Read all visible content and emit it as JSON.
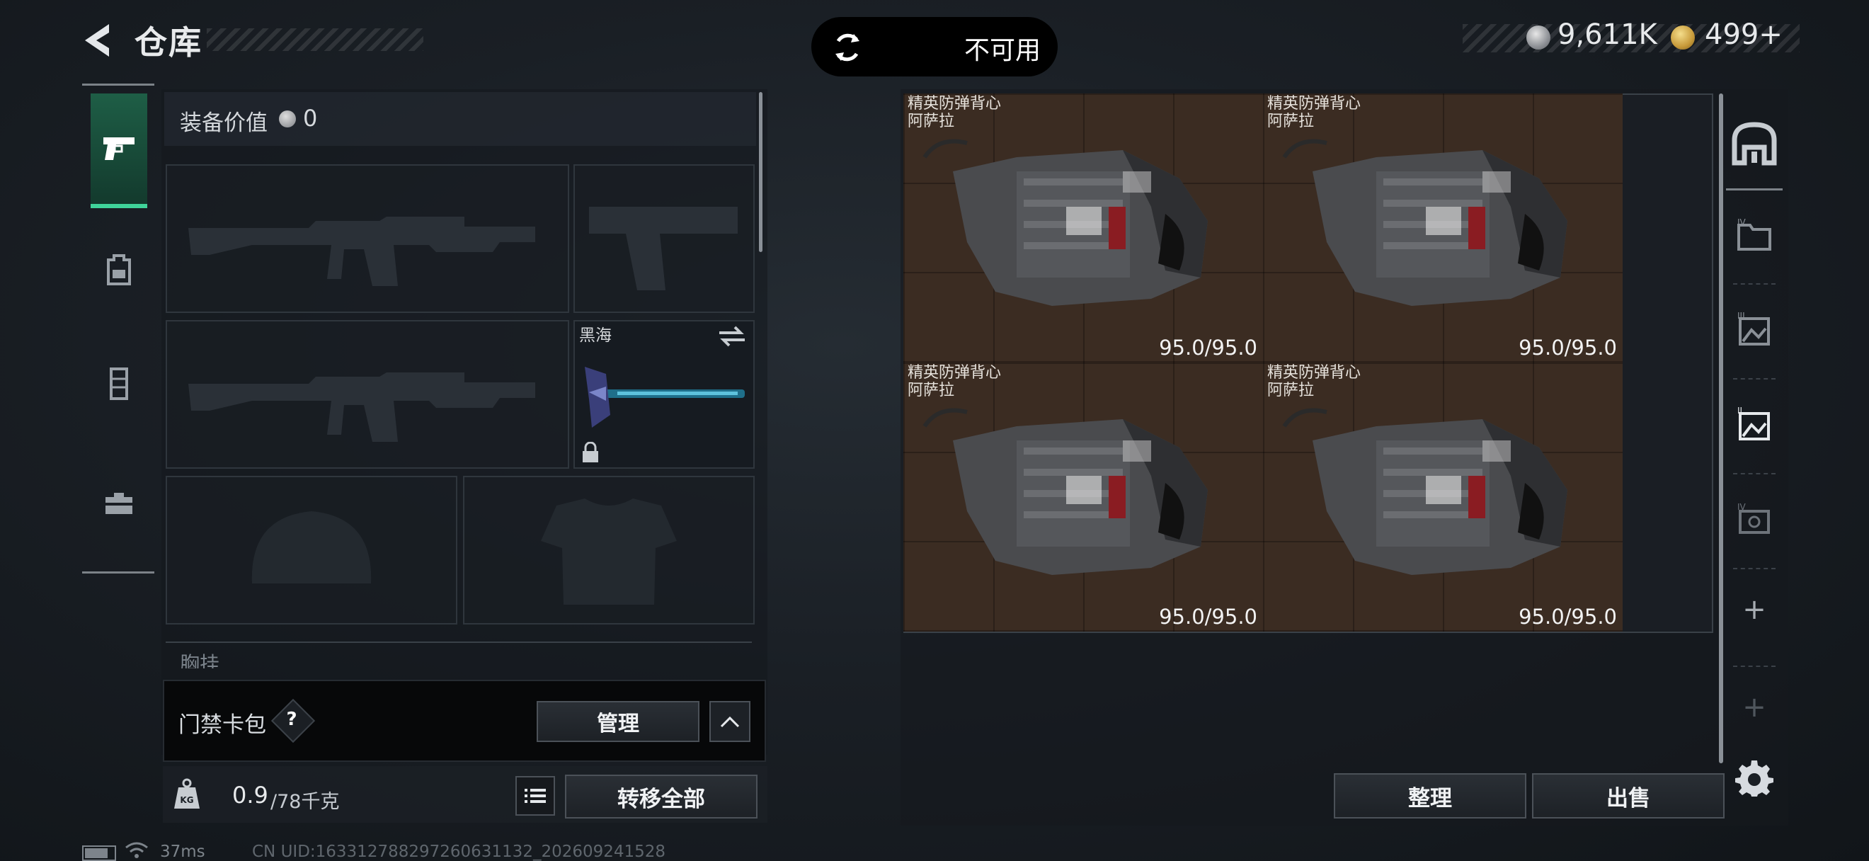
{
  "header": {
    "title": "仓库",
    "status_text": "不可用",
    "currency_1": "9,611K",
    "currency_2": "499+"
  },
  "left_tabs": [
    {
      "icon": "pistol-icon",
      "active": true
    },
    {
      "icon": "backpack-icon",
      "active": false
    },
    {
      "icon": "chest-rig-icon",
      "active": false
    },
    {
      "icon": "toolbox-icon",
      "active": false
    }
  ],
  "loadout": {
    "equipment_value_label": "装备价值",
    "equipment_value": "0",
    "melee_name": "黑海",
    "chest_rig_label": "胸挂",
    "keycard_label": "门禁卡包",
    "keycard_help": "?",
    "manage_label": "管理",
    "weight_current": "0.9",
    "weight_max": "/78千克",
    "transfer_all_label": "转移全部"
  },
  "status_footer": {
    "ping": "37ms",
    "uid": "CN UID:16331278829726063113​2_202609241528"
  },
  "stash": {
    "items": [
      {
        "name_line1": "精英防弹背心",
        "name_line2": "阿萨拉",
        "durability": "95.0/95.0"
      },
      {
        "name_line1": "精英防弹背心",
        "name_line2": "阿萨拉",
        "durability": "95.0/95.0"
      },
      {
        "name_line1": "精英防弹背心",
        "name_line2": "阿萨拉",
        "durability": "95.0/95.0"
      },
      {
        "name_line1": "精英防弹背心",
        "name_line2": "阿萨拉",
        "durability": "95.0/95.0"
      }
    ],
    "sort_label": "整理",
    "sell_label": "出售",
    "add_tab_label": "+"
  },
  "colors": {
    "active_tab": "#1e5e46",
    "active_tab_accent": "#3fd49a",
    "item_background": "#3b2c22"
  }
}
